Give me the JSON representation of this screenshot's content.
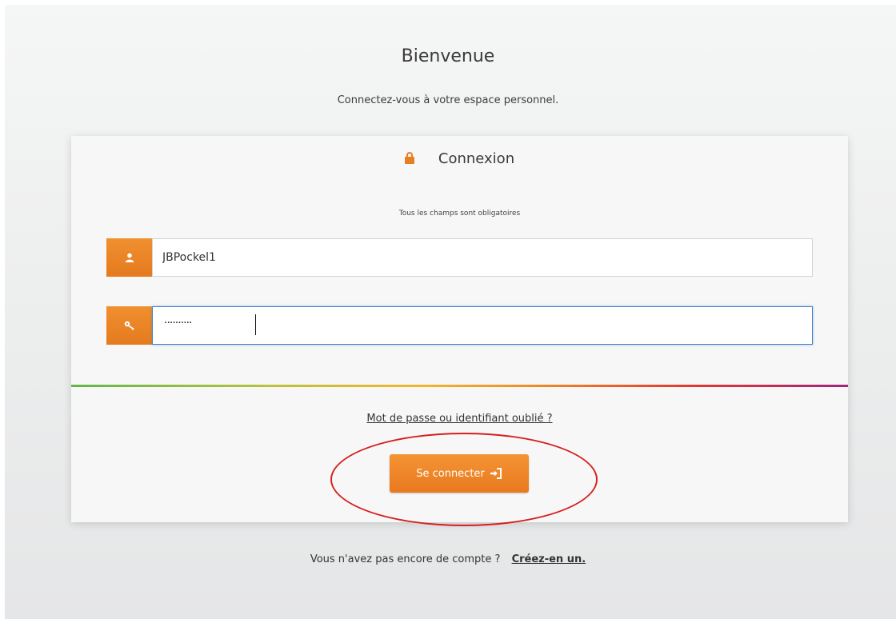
{
  "header": {
    "title": "Bienvenue",
    "subtitle": "Connectez-vous à votre espace personnel."
  },
  "login_card": {
    "title": "Connexion",
    "required_note": "Tous les champs sont obligatoires",
    "username": {
      "value": "JBPockel1",
      "icon": "user-icon"
    },
    "password": {
      "masked_value": "··········",
      "icon": "key-icon"
    },
    "forgot_link": "Mot de passe ou identifiant oublié ?",
    "submit_label": "Se connecter"
  },
  "footer": {
    "prompt": "Vous n'avez pas encore de compte ?",
    "signup_link": "Créez-en un."
  },
  "colors": {
    "accent": "#e87e22",
    "focus_border": "#3f7fc9",
    "annotation_circle": "#d61f1f"
  }
}
